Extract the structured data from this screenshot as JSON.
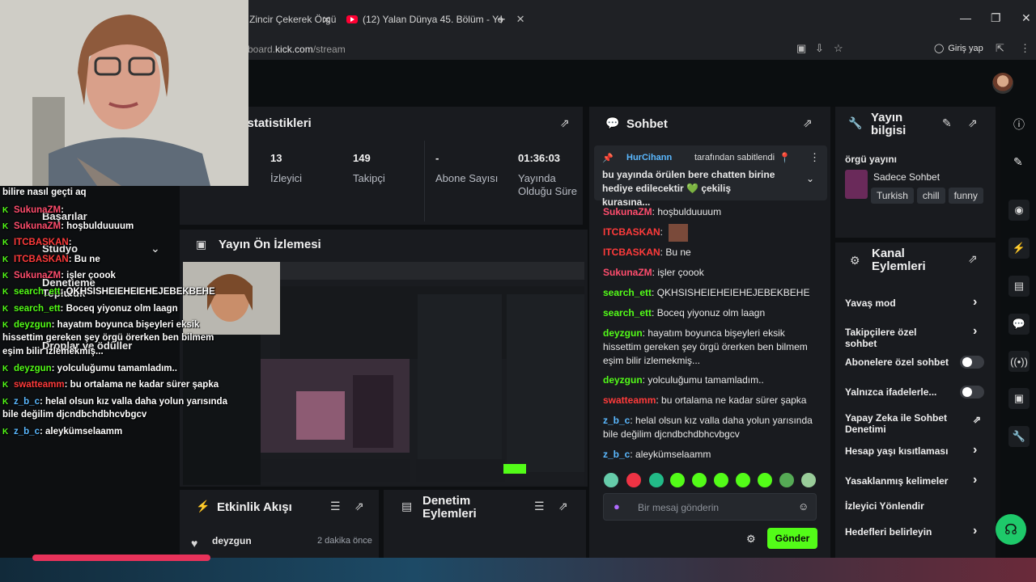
{
  "browser": {
    "tabs": [
      {
        "title": "Zincir Çekerek Örgü"
      },
      {
        "title": "(12) Yalan Dünya 45. Bölüm - Yo"
      }
    ],
    "url_prefix": "board.",
    "url_domain": "kick.com",
    "url_path": "/stream",
    "login_label": "Giriş yap"
  },
  "stats": {
    "title_fragment": "n İstatistikleri",
    "items": [
      {
        "value": "13",
        "label": "İzleyici"
      },
      {
        "value": "149",
        "label": "Takipçi"
      },
      {
        "value": "-",
        "label": "Abone Sayısı"
      },
      {
        "value": "01:36:03",
        "label": "Yayında Olduğu Süre"
      }
    ]
  },
  "preview": {
    "title": "Yayın Ön İzlemesi"
  },
  "activity": {
    "title": "Etkinlik Akışı",
    "items": [
      {
        "user": "deyzgun",
        "time": "2 dakika önce"
      }
    ]
  },
  "mod_actions": {
    "title": "Denetim Eylemleri"
  },
  "chat": {
    "title": "Sohbet",
    "pinned": {
      "user": "HurCihann",
      "suffix": "tarafından sabitlendi",
      "text": "bu yayında örülen bere chatten birine hediye edilecektir 💚 çekiliş kurasına..."
    },
    "messages": [
      {
        "user": "SukunaZM",
        "text": "hoşbulduuuum",
        "color": "#ff4d6d"
      },
      {
        "user": "ITCBASKAN",
        "text": "",
        "color": "#ff3b3b"
      },
      {
        "user": "ITCBASKAN",
        "text": "Bu ne",
        "color": "#ff3b3b"
      },
      {
        "user": "SukunaZM",
        "text": "işler çoook",
        "color": "#ff4d6d"
      },
      {
        "user": "search_ett",
        "text": "QKHSISHEIEHEIEHEJEBEKBEHE",
        "color": "#53fc18"
      },
      {
        "user": "search_ett",
        "text": "Boceq yiyonuz olm laagn",
        "color": "#53fc18"
      },
      {
        "user": "deyzgun",
        "text": "hayatım boyunca bişeyleri eksik hissettim gereken şey örgü örerken ben bilmem eşim bilir izlemekmiş...",
        "color": "#53fc18"
      },
      {
        "user": "deyzgun",
        "text": "yolculuğumu tamamladım..",
        "color": "#53fc18"
      },
      {
        "user": "swatteamm",
        "text": "bu ortalama ne kadar sürer şapka",
        "color": "#ff3b3b"
      },
      {
        "user": "z_b_c",
        "text": "helal olsun kız valla daha yolun yarısında bile değilim djcndbchdbhcvbgcv",
        "color": "#5ab8ff"
      },
      {
        "user": "z_b_c",
        "text": "aleykümselaamm",
        "color": "#5ab8ff"
      }
    ],
    "input_placeholder": "Bir mesaj gönderin",
    "send_label": "Gönder"
  },
  "stream_info": {
    "title": "Yayın bilgisi",
    "stream_title": "örgü yayını",
    "category": "Sadece Sohbet",
    "tags": [
      "Turkish",
      "chill",
      "funny"
    ]
  },
  "channel_actions": {
    "title": "Kanal Eylemleri",
    "items": [
      {
        "label": "Yavaş mod",
        "control": "chevron"
      },
      {
        "label": "Takipçilere özel sohbet",
        "control": "chevron"
      },
      {
        "label": "Abonelere özel sohbet",
        "control": "toggle"
      },
      {
        "label": "Yalnızca ifadelerle...",
        "control": "toggle"
      },
      {
        "label": "Yapay Zeka ile Sohbet Denetimi",
        "control": "external"
      },
      {
        "label": "Hesap yaşı kısıtlaması",
        "control": "chevron"
      },
      {
        "label": "Yasaklanmış kelimeler",
        "control": "chevron"
      },
      {
        "label": "İzleyici Yönlendir",
        "control": "none"
      },
      {
        "label": "Hedefleri belirleyin",
        "control": "chevron"
      }
    ]
  },
  "overlay": {
    "ghost_menu": [
      "Başarılar",
      "Stüdyo",
      "Denetleme",
      "Topluluk",
      "Droplar ve ödüller"
    ],
    "chat_top": "bilire nasıl geçti aq",
    "chat": [
      {
        "user": "SukunaZM",
        "text": ""
      },
      {
        "user": "SukunaZM",
        "text": "hoşbulduuuum"
      },
      {
        "user": "ITCBASKAN",
        "text": ""
      },
      {
        "user": "ITCBASKAN",
        "text": "Bu ne"
      },
      {
        "user": "SukunaZM",
        "text": "işler çoook"
      },
      {
        "user": "search_ett",
        "text": "QKHSISHEIEHEIEHEJEBEKBEHE"
      },
      {
        "user": "search_ett",
        "text": "Boceq yiyonuz olm laagn"
      },
      {
        "user": "deyzgun",
        "text": "hayatım boyunca bişeyleri eksik"
      },
      {
        "user": "",
        "text": "hissettim gereken şey örgü örerken ben bilmem"
      },
      {
        "user": "",
        "text": "eşim bilir izlemekmiş..."
      },
      {
        "user": "deyzgun",
        "text": "yolculuğumu tamamladım.."
      },
      {
        "user": "swatteamm",
        "text": "bu ortalama ne kadar sürer şapka"
      },
      {
        "user": "z_b_c",
        "text": "helal olsun kız valla daha yolun yarısında"
      },
      {
        "user": "",
        "text": "bile değilim djcndbchdbhcvbgcv"
      },
      {
        "user": "z_b_c",
        "text": "aleykümselaamm"
      }
    ]
  },
  "colors": {
    "accent": "#53fc18",
    "panel": "#191b1f",
    "page": "#0d0f11"
  }
}
